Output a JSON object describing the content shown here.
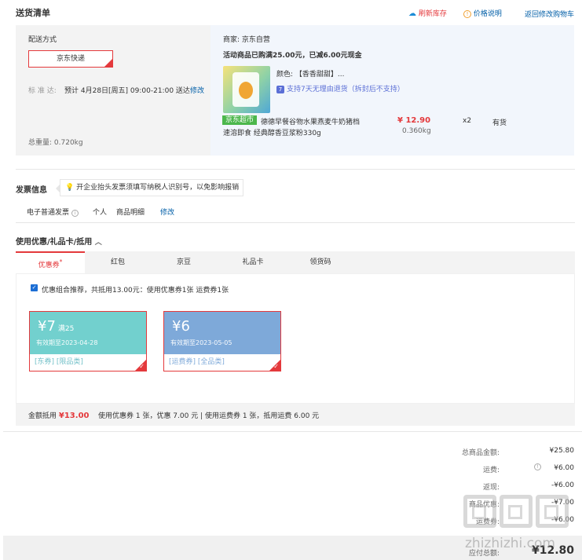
{
  "header": {
    "title": "送货清单",
    "refresh_label": "刷新库存",
    "price_info_label": "价格说明",
    "back_label": "返回修改购物车"
  },
  "delivery": {
    "method_label": "配送方式",
    "method_value": "京东快递",
    "standard_label": "标 准 达:",
    "standard_value": "预计 4月28日[周五] 09:00-21:00 送达",
    "modify_label": "修改",
    "weight_label": "总重量:",
    "weight_value": "0.720kg"
  },
  "merchant": {
    "label": "商家:",
    "name": "京东自营",
    "promo": "活动商品已购满25.00元，已减6.00元现金"
  },
  "product": {
    "color_label": "颜色:",
    "color_value": "【香香甜甜】...",
    "return_policy": "支持7天无理由退货（拆封后不支持）",
    "store_tag": "京东超市",
    "name_line1": "德德早餐谷物水果燕麦牛奶猪档",
    "name_line2": "速溶即食 经典醇香豆浆粉330g",
    "price": "¥ 12.90",
    "qty": "x2",
    "stock": "有货",
    "weight": "0.360kg"
  },
  "invoice": {
    "title": "发票信息",
    "tip": "开企业抬头发票须填写纳税人识别号，以免影响报销",
    "type": "电子普通发票",
    "personal": "个人",
    "detail": "商品明细",
    "modify": "修改"
  },
  "discount": {
    "title": "使用优惠/礼品卡/抵用",
    "tabs": [
      "优惠券",
      "红包",
      "京豆",
      "礼品卡",
      "领货码"
    ],
    "recommend": "优惠组合推荐，共抵用13.00元：使用优惠券1张 运费券1张",
    "coupons": [
      {
        "amount": "¥7",
        "cond": "满25",
        "valid": "有效期至2023-04-28",
        "tags": "[东券] [限品类]",
        "color": "#72d0ce"
      },
      {
        "amount": "¥6",
        "cond": "",
        "valid": "有效期至2023-05-05",
        "tags": "[运费券] [全品类]",
        "color": "#7ea9d9"
      }
    ],
    "total_label": "金额抵用",
    "total_value": "¥13.00",
    "total_detail": "使用优惠券 1 张，优惠 7.00 元 | 使用运费券 1 张，抵用运费 6.00 元"
  },
  "totals": {
    "goods_label": "总商品金额:",
    "goods_value": "¥25.80",
    "freight_label": "运费:",
    "freight_value": "¥6.00",
    "cashback_label": "返现:",
    "cashback_value": "-¥6.00",
    "coupon_label": "商品优惠:",
    "coupon_value": "-¥7.00",
    "freight_coupon_label": "运费券:",
    "freight_coupon_value": "-¥6.00",
    "pay_label": "应付总额:",
    "pay_value": "¥12.80"
  },
  "watermark": "zhizhizhi.com",
  "colors": {
    "accent": "#e4393c",
    "link": "#005ea7",
    "store_green": "#4cb74c"
  }
}
